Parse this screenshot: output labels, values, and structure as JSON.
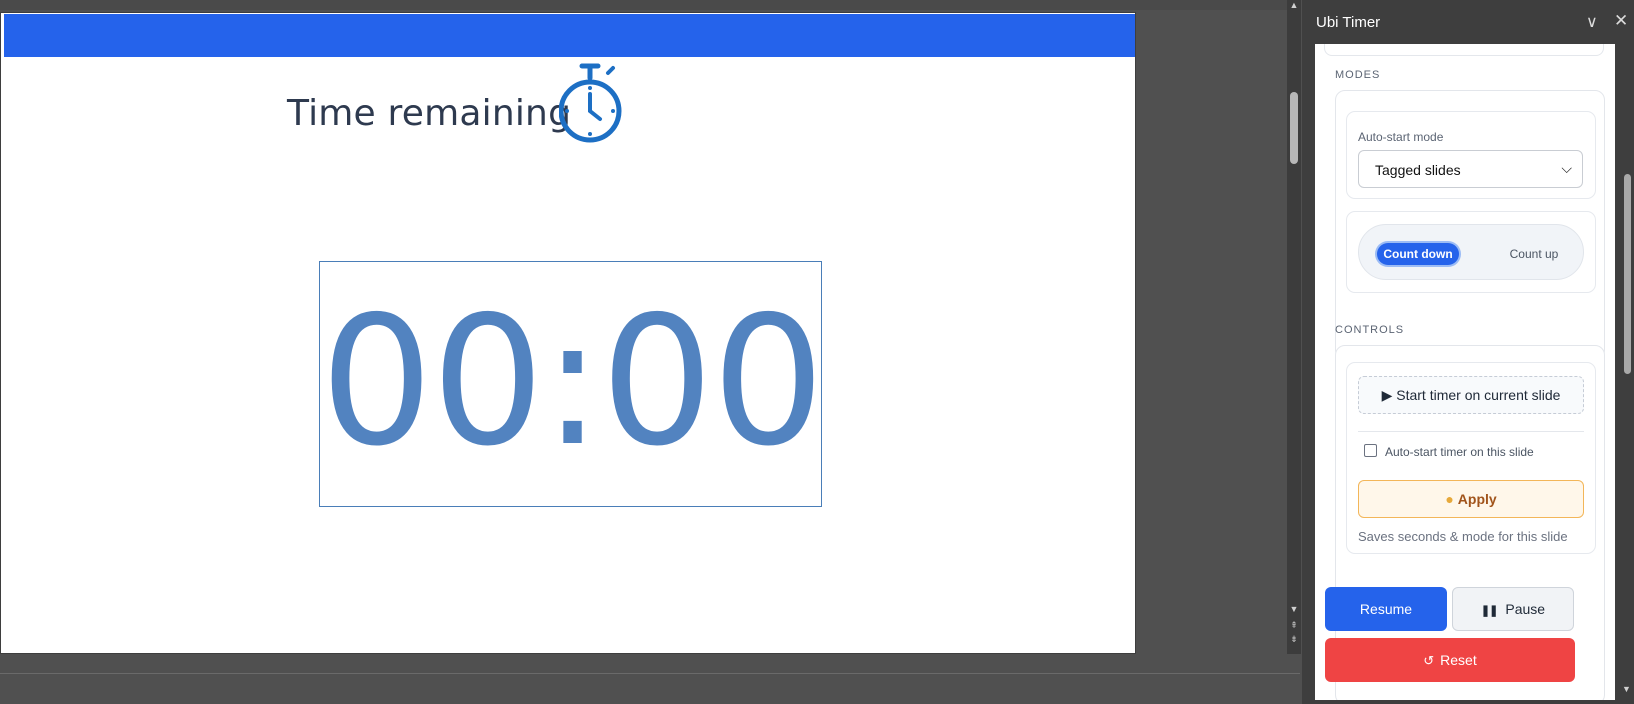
{
  "slide": {
    "title": "Time remaining",
    "timer_value": "00:00",
    "accent_color": "#2563eb",
    "timer_color": "#5283c0",
    "icon": "stopwatch-icon"
  },
  "pane": {
    "title": "Ubi Timer",
    "collapse_icon": "chevron-down-icon",
    "close_icon": "close-icon"
  },
  "modes": {
    "section_label": "MODES",
    "auto_start_label": "Auto-start mode",
    "auto_start_value": "Tagged slides",
    "direction": {
      "options": [
        "Count down",
        "Count up"
      ],
      "selected": "Count down"
    }
  },
  "controls": {
    "section_label": "CONTROLS",
    "start_button": "Start timer on current slide",
    "start_icon": "play-icon",
    "auto_start_checkbox_label": "Auto-start timer on this slide",
    "auto_start_checked": false,
    "apply_button": "Apply",
    "apply_icon": "lightbulb-icon",
    "apply_hint": "Saves seconds & mode for this slide",
    "resume_button": "Resume",
    "pause_button": "Pause",
    "pause_icon": "pause-icon",
    "reset_button": "Reset",
    "reset_icon": "reset-icon"
  },
  "colors": {
    "primary": "#2563eb",
    "danger": "#ef4444",
    "warning_bg": "#fff7ea",
    "warning_text": "#a1541b"
  }
}
